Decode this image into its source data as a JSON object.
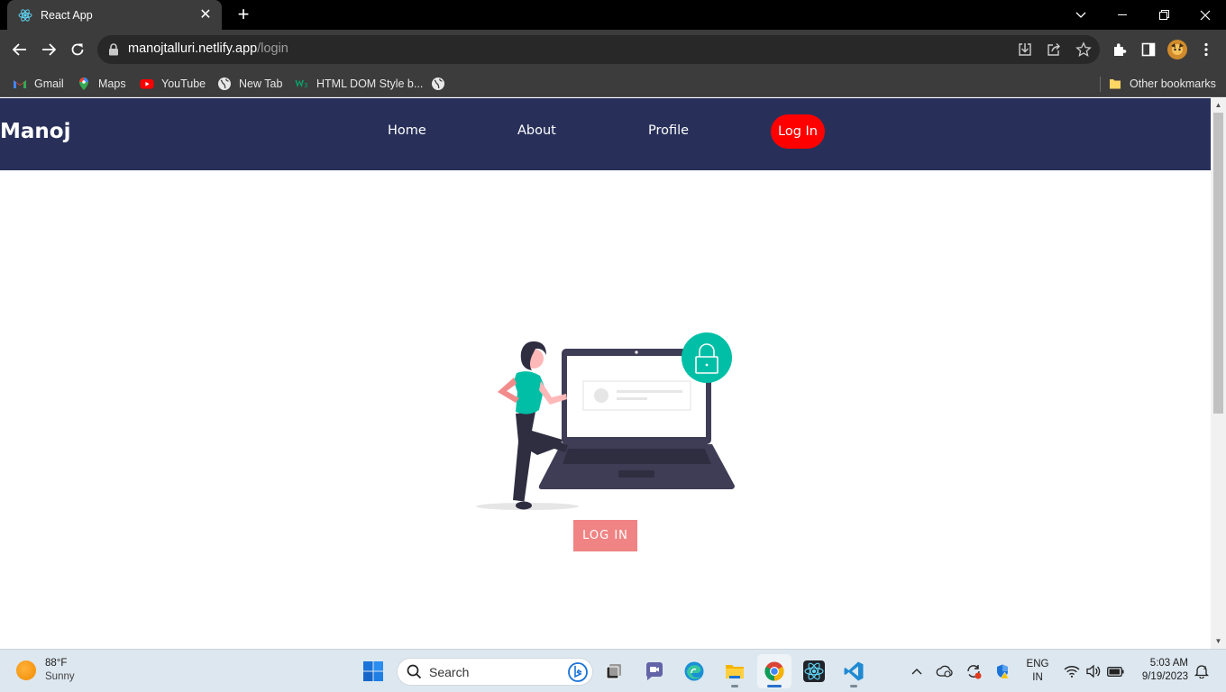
{
  "browser": {
    "tab": {
      "title": "React App",
      "favicon": "react-icon"
    },
    "new_tab_label": "+",
    "url": {
      "host": "manojtalluri.netlify.app",
      "path": "/login"
    },
    "bookmarks": [
      {
        "label": "Gmail",
        "icon": "gmail-icon"
      },
      {
        "label": "Maps",
        "icon": "maps-icon"
      },
      {
        "label": "YouTube",
        "icon": "youtube-icon"
      },
      {
        "label": "New Tab",
        "icon": "globe-icon"
      },
      {
        "label": "HTML DOM Style b...",
        "icon": "w3schools-icon"
      },
      {
        "label": "",
        "icon": "globe-icon"
      }
    ],
    "other_bookmarks": "Other bookmarks"
  },
  "page": {
    "brand": "Manoj",
    "nav": [
      "Home",
      "About",
      "Profile"
    ],
    "nav_login": "Log In",
    "login_button": "LOG IN",
    "colors": {
      "navbar": "#28305a",
      "nav_login": "#ff0000",
      "login_button": "#f08484",
      "accent": "#00bfa6"
    }
  },
  "taskbar": {
    "weather": {
      "temp": "88°F",
      "condition": "Sunny"
    },
    "search_placeholder": "Search",
    "language": {
      "line1": "ENG",
      "line2": "IN"
    },
    "clock": {
      "time": "5:03 AM",
      "date": "9/19/2023"
    }
  }
}
